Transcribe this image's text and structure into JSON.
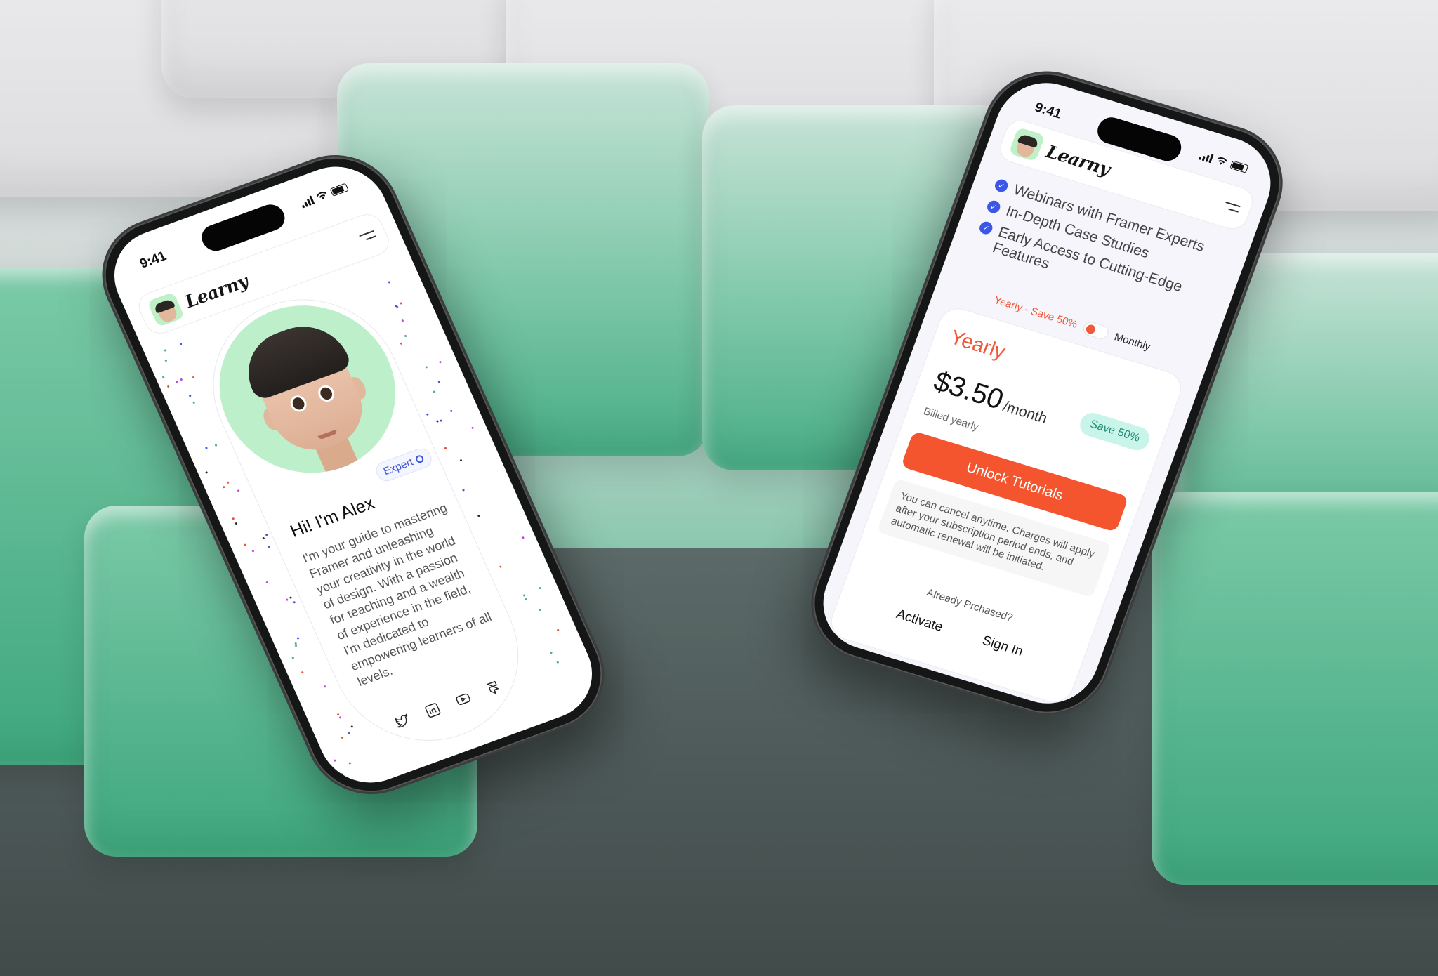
{
  "status_bar": {
    "time": "9:41"
  },
  "brand": {
    "name": "Learny"
  },
  "profile": {
    "badge": "Expert",
    "greeting": "Hi! I'm Alex",
    "bio": "I'm your guide to mastering Framer and unleashing your creativity in the world of design. With a passion for teaching and a wealth of experience in the field, I'm dedicated to empowering learners of all levels.",
    "socials": [
      "twitter-icon",
      "linkedin-icon",
      "youtube-icon",
      "framer-icon"
    ]
  },
  "pricing": {
    "features": [
      "Webinars with Framer Experts",
      "In-Depth Case Studies",
      "Early Access to Cutting-Edge Features"
    ],
    "toggle": {
      "yearly_label": "Yearly - Save 50%",
      "monthly_label": "Monthly",
      "selected": "Yearly"
    },
    "plan": {
      "name": "Yearly",
      "price": "$3.50",
      "unit": "/month",
      "billing": "Billed yearly",
      "save_badge": "Save 50%",
      "cta": "Unlock Tutorials",
      "note": "You can cancel anytime. Charges will apply after your subscription period ends, and automatic renewal will be initiated.",
      "already": "Already Prchased?",
      "activate": "Activate",
      "sign_in": "Sign In"
    }
  },
  "colors": {
    "accent": "#f4552f",
    "brand_blue": "#3a57e6",
    "avatar_bg": "#bcefca",
    "save_badge_bg": "#c9f4ea"
  }
}
